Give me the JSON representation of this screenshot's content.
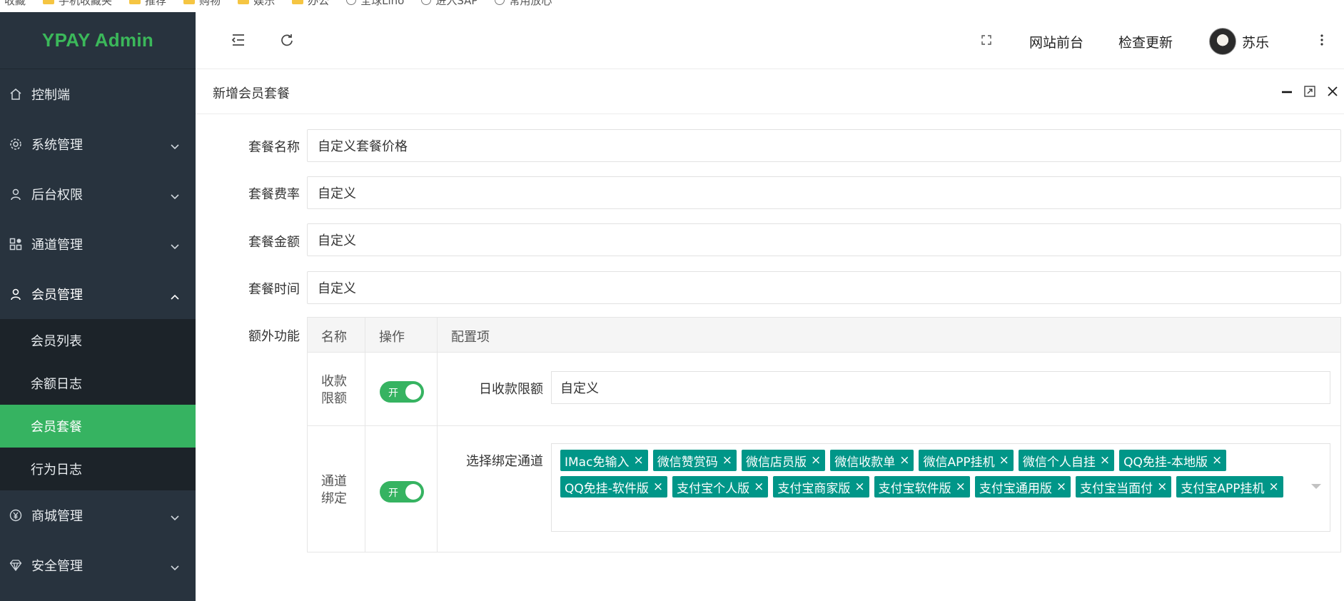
{
  "bookmarks": [
    "收藏",
    "手机收藏夹",
    "推荐",
    "购物",
    "娱乐",
    "办公",
    "全球Lino",
    "进入SAP",
    "常用放心"
  ],
  "sidebar": {
    "logo": "YPAY Admin",
    "items": [
      {
        "label": "控制端",
        "icon": "home-icon"
      },
      {
        "label": "系统管理",
        "icon": "gear-icon"
      },
      {
        "label": "后台权限",
        "icon": "user-icon"
      },
      {
        "label": "通道管理",
        "icon": "grid-icon"
      },
      {
        "label": "会员管理",
        "icon": "user-icon",
        "expanded": true
      },
      {
        "label": "商城管理",
        "icon": "yen-icon"
      },
      {
        "label": "安全管理",
        "icon": "diamond-icon"
      }
    ],
    "submenu": [
      {
        "label": "会员列表"
      },
      {
        "label": "余额日志"
      },
      {
        "label": "会员套餐",
        "active": true
      },
      {
        "label": "行为日志"
      }
    ]
  },
  "header": {
    "frontend_label": "网站前台",
    "update_label": "检查更新",
    "username": "苏乐"
  },
  "page": {
    "title": "新增会员套餐"
  },
  "form": {
    "name_label": "套餐名称",
    "name_value": "自定义套餐价格",
    "rate_label": "套餐费率",
    "rate_value": "自定义",
    "amount_label": "套餐金额",
    "amount_value": "自定义",
    "time_label": "套餐时间",
    "time_value": "自定义",
    "extra_label": "额外功能"
  },
  "extra_table": {
    "headers": {
      "name": "名称",
      "action": "操作",
      "config": "配置项"
    },
    "row1": {
      "name_line1": "收款",
      "name_line2": "限额",
      "toggle": "开",
      "config_label": "日收款限额",
      "config_value": "自定义"
    },
    "row2": {
      "name_line1": "通道",
      "name_line2": "绑定",
      "toggle": "开",
      "config_label": "选择绑定通道"
    },
    "tags": [
      "IMac免输入",
      "微信赞赏码",
      "微信店员版",
      "微信收款单",
      "微信APP挂机",
      "微信个人自挂",
      "QQ免挂-本地版",
      "QQ免挂-软件版",
      "支付宝个人版",
      "支付宝商家版",
      "支付宝软件版",
      "支付宝通用版",
      "支付宝当面付",
      "支付宝APP挂机"
    ]
  },
  "colors": {
    "sidebar_bg": "#28333e",
    "submenu_bg": "#1c2329",
    "accent_green": "#36b361",
    "logo_green": "#3bb85a",
    "tag_teal": "#009688"
  }
}
